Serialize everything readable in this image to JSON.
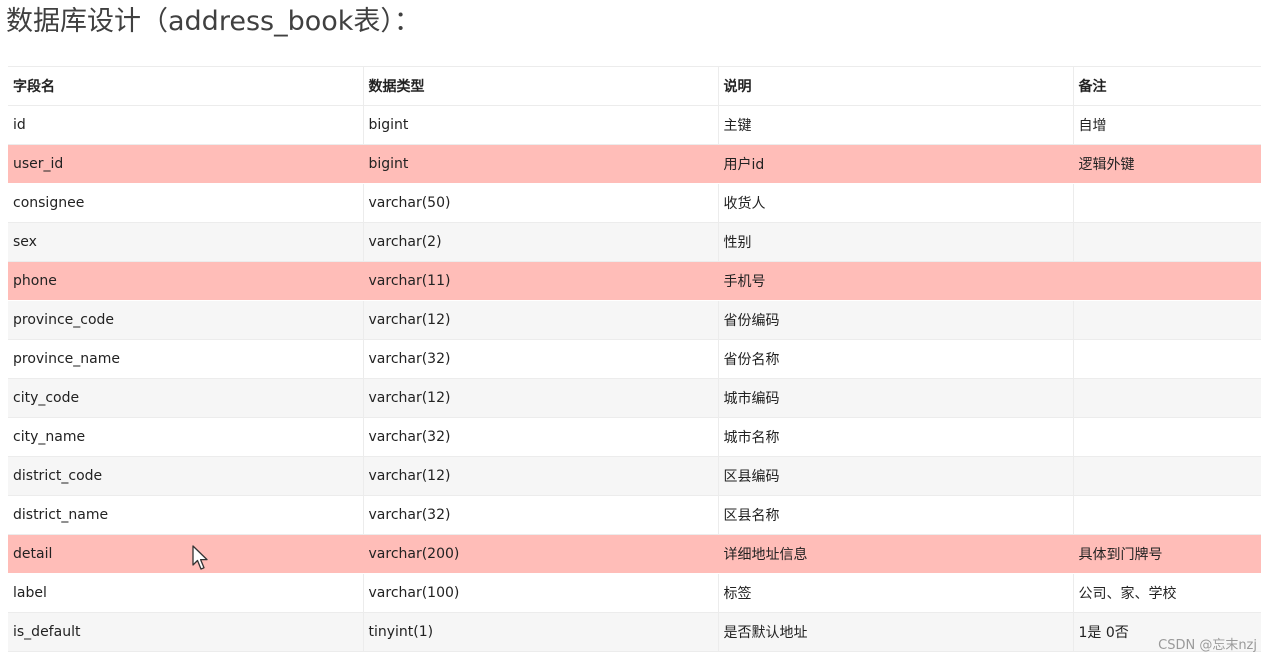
{
  "page": {
    "title": "数据库设计（address_book表）："
  },
  "table": {
    "headers": [
      "字段名",
      "数据类型",
      "说明",
      "备注"
    ],
    "rows": [
      {
        "field": "id",
        "type": "bigint",
        "desc": "主键",
        "note": "自增",
        "highlight": false
      },
      {
        "field": "user_id",
        "type": "bigint",
        "desc": "用户id",
        "note": "逻辑外键",
        "highlight": true
      },
      {
        "field": "consignee",
        "type": "varchar(50)",
        "desc": "收货人",
        "note": "",
        "highlight": false
      },
      {
        "field": "sex",
        "type": "varchar(2)",
        "desc": "性别",
        "note": "",
        "highlight": false
      },
      {
        "field": "phone",
        "type": "varchar(11)",
        "desc": "手机号",
        "note": "",
        "highlight": true
      },
      {
        "field": "province_code",
        "type": "varchar(12)",
        "desc": "省份编码",
        "note": "",
        "highlight": false
      },
      {
        "field": "province_name",
        "type": "varchar(32)",
        "desc": "省份名称",
        "note": "",
        "highlight": false
      },
      {
        "field": "city_code",
        "type": "varchar(12)",
        "desc": "城市编码",
        "note": "",
        "highlight": false
      },
      {
        "field": "city_name",
        "type": "varchar(32)",
        "desc": "城市名称",
        "note": "",
        "highlight": false
      },
      {
        "field": "district_code",
        "type": "varchar(12)",
        "desc": "区县编码",
        "note": "",
        "highlight": false
      },
      {
        "field": "district_name",
        "type": "varchar(32)",
        "desc": "区县名称",
        "note": "",
        "highlight": false
      },
      {
        "field": "detail",
        "type": "varchar(200)",
        "desc": "详细地址信息",
        "note": "具体到门牌号",
        "highlight": true
      },
      {
        "field": "label",
        "type": "varchar(100)",
        "desc": "标签",
        "note": "公司、家、学校",
        "highlight": false
      },
      {
        "field": "is_default",
        "type": "tinyint(1)",
        "desc": "是否默认地址",
        "note": "1是 0否",
        "highlight": false
      }
    ],
    "highlight_color": "#ffbdb8"
  },
  "cursor": {
    "icon": "mouse-pointer-icon"
  },
  "watermark": {
    "text": "CSDN @忘末nzj"
  }
}
